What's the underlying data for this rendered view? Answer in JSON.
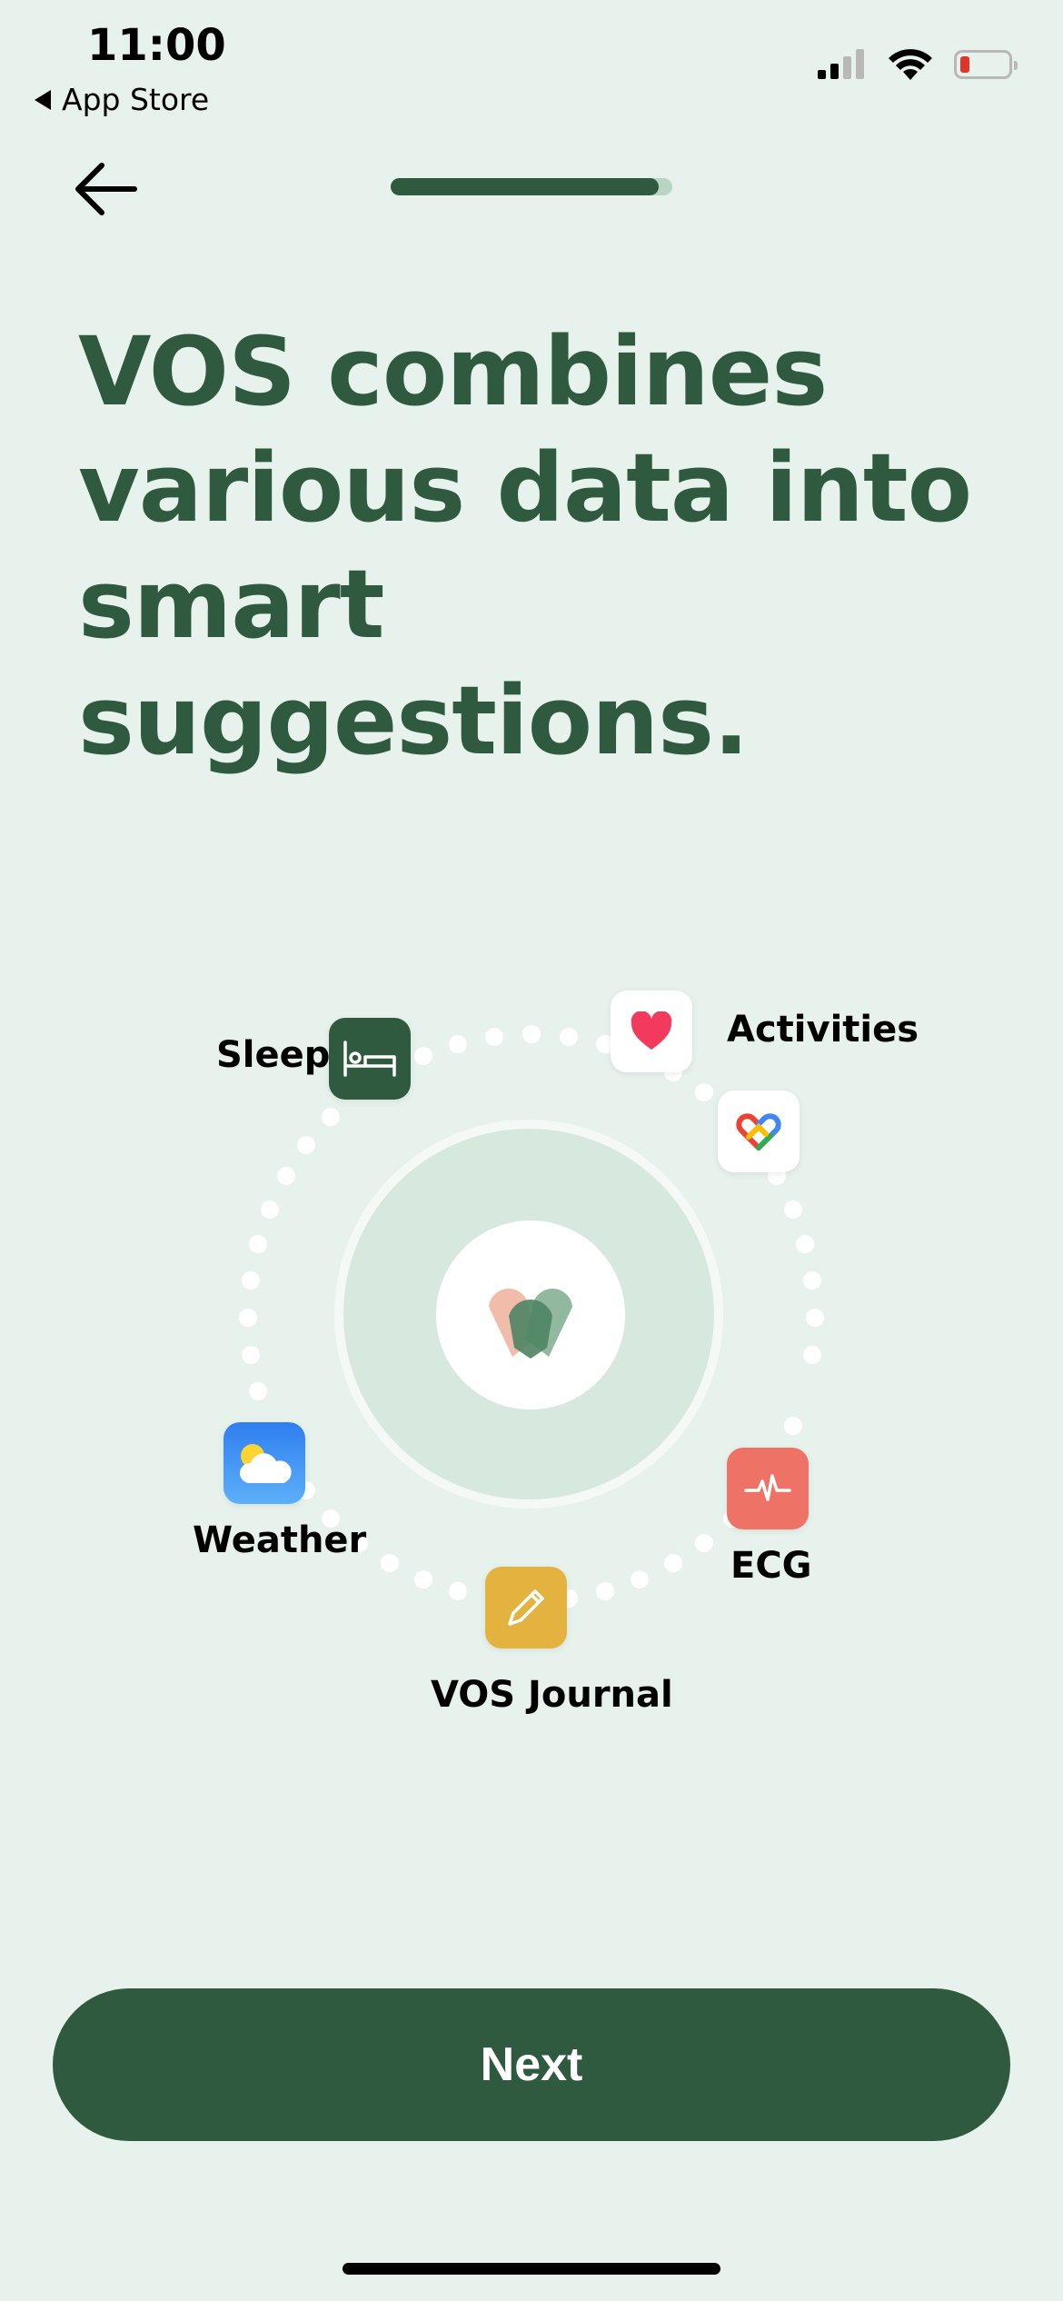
{
  "status_bar": {
    "time": "11:00",
    "back_app_label": "App Store"
  },
  "onboarding": {
    "progress": 0.95,
    "headline": "VOS combines various data into smart suggestions."
  },
  "sources": {
    "sleep": "Sleep",
    "activities": "Activities",
    "weather": "Weather",
    "ecg": "ECG",
    "journal": "VOS Journal"
  },
  "footer": {
    "next_label": "Next"
  },
  "colors": {
    "brand_green": "#2f5a3f",
    "background": "#e8f2ec",
    "ecg_tile": "#ee7366",
    "journal_tile": "#e4b23e",
    "sleep_tile": "#2f5a3f"
  }
}
